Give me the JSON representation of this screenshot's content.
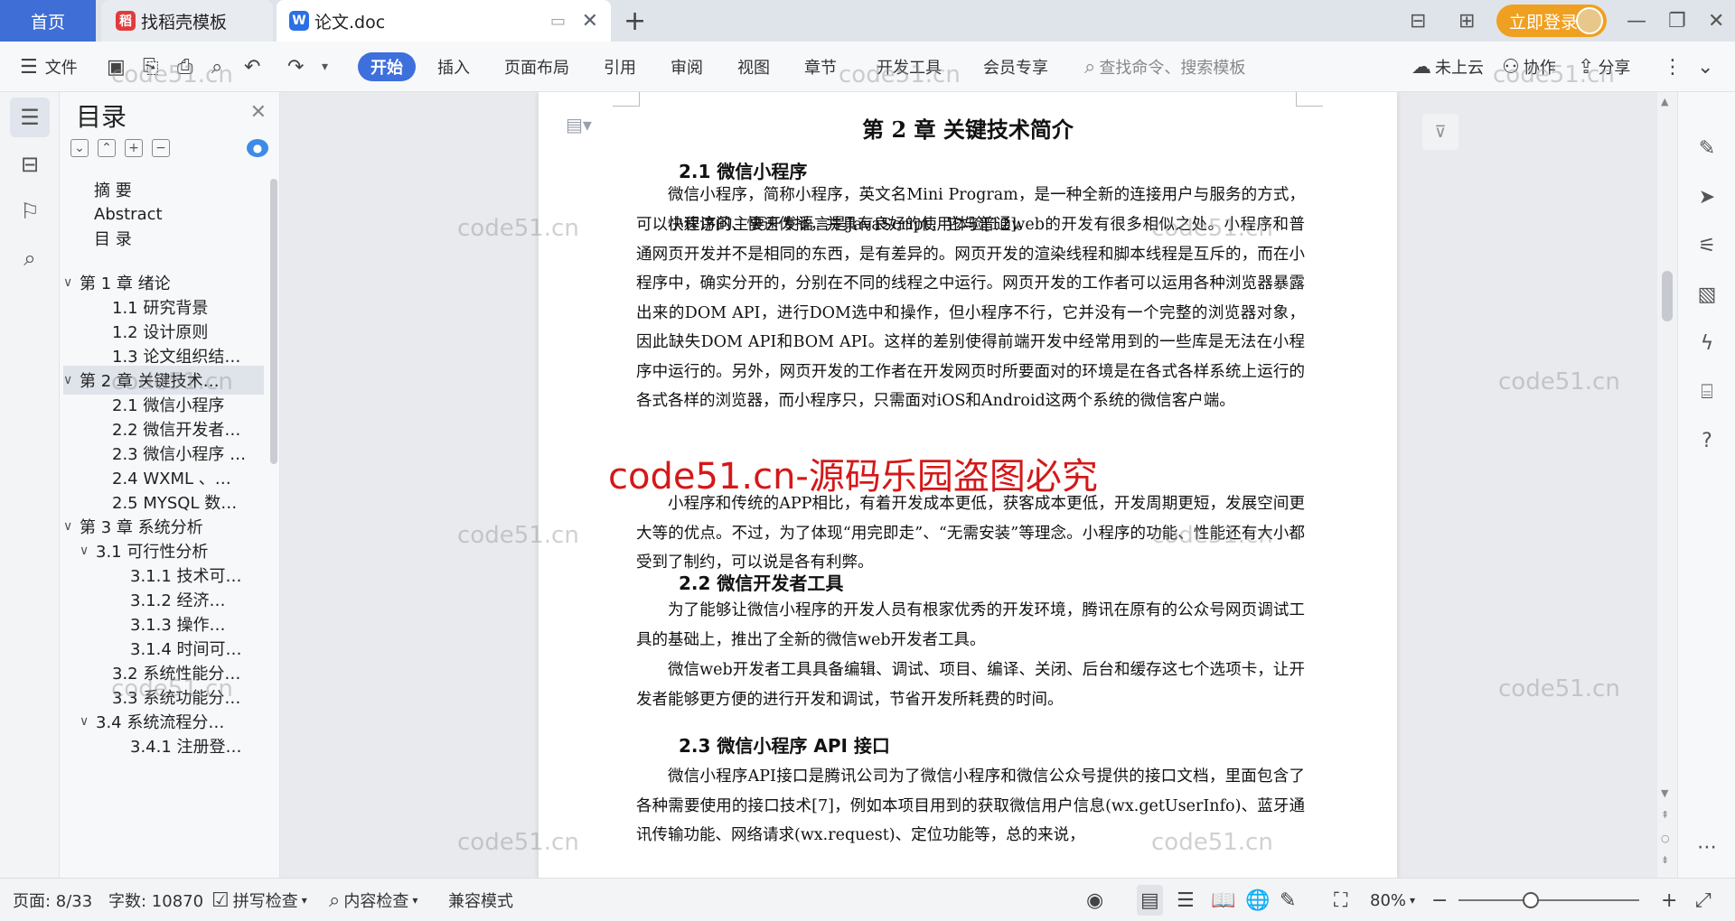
{
  "titlebar": {
    "home_tab": "首页",
    "tabs": [
      {
        "label": "找稻壳模板",
        "logo": "稻"
      },
      {
        "label": "论文.doc",
        "logo": "W"
      }
    ],
    "new_tab": "+",
    "login_label": "立即登录"
  },
  "ribbon": {
    "file_label": "文件",
    "tabs": [
      "开始",
      "插入",
      "页面布局",
      "引用",
      "审阅",
      "视图",
      "章节",
      "开发工具",
      "会员专享"
    ],
    "search_placeholder": "查找命令、搜索模板",
    "cloud_label": "未上云",
    "collab_label": "协作",
    "share_label": "分享"
  },
  "toc": {
    "title": "目录",
    "items": [
      {
        "label": "摘  要"
      },
      {
        "label": "Abstract"
      },
      {
        "label": "目    录"
      },
      {
        "label": "第 1 章   绪论",
        "chev": "∨"
      },
      {
        "label": "1.1 研究背景"
      },
      {
        "label": "1.2 设计原则"
      },
      {
        "label": "1.3 论文组织结…"
      },
      {
        "label": "第 2 章   关键技术…",
        "chev": "∨",
        "selected": true
      },
      {
        "label": "2.1  微信小程序"
      },
      {
        "label": "2.2  微信开发者…"
      },
      {
        "label": "2.3 微信小程序 …"
      },
      {
        "label": "2.4 WXML  、…"
      },
      {
        "label": "2.5 MYSQL 数…"
      },
      {
        "label": "第 3 章   系统分析",
        "chev": "∨"
      },
      {
        "label": "3.1  可行性分析",
        "chev": "∨"
      },
      {
        "label": "3.1.1 技术可…"
      },
      {
        "label": "3.1.2  经济…"
      },
      {
        "label": "3.1.3  操作…"
      },
      {
        "label": "3.1.4 时间可…"
      },
      {
        "label": "3.2  系统性能分…"
      },
      {
        "label": "3.3  系统功能分…"
      },
      {
        "label": "3.4  系统流程分…",
        "chev": "∨"
      },
      {
        "label": "3.4.1 注册登…"
      }
    ]
  },
  "document": {
    "chapter_title": "第 2 章    关键技术简介",
    "sections": [
      {
        "heading": "2.1  微信小程序"
      },
      {
        "heading": "2.2  微信开发者工具"
      },
      {
        "heading": "2.3 微信小程序 API 接口"
      }
    ],
    "paragraphs": [
      "微信小程序，简称小程序，英文名Mini Program，是一种全新的连接用户与服务的方式，可以快速访问、快速传播，并具有良好的使用体验[12]。",
      "小程序的主要开发语言是JavaScript，它与普通web的开发有很多相似之处。小程序和普通网页开发并不是相同的东西，是有差异的。网页开发的渲染线程和脚本线程是互斥的，而在小程序中，确实分开的，分别在不同的线程之中运行。网页开发的工作者可以运用各种浏览器暴露出来的DOM API，进行DOM选中和操作，但小程序不行，它并没有一个完整的浏览器对象，因此缺失DOM API和BOM API。这样的差别使得前端开发中经常用到的一些库是无法在小程序中运行的。另外，网页开发的工作者在开发网页时所要面对的环境是在各式各样系统上运行的各式各样的浏览器，而小程序只，只需面对iOS和Android这两个系统的微信客户端。",
      "小程序和传统的APP相比，有着开发成本更低，获客成本更低，开发周期更短，发展空间更大等的优点。不过，为了体现“用完即走”、“无需安装”等理念。小程序的功能、性能还有大小都受到了制约，可以说是各有利弊。",
      "为了能够让微信小程序的开发人员有根家优秀的开发环境，腾讯在原有的公众号网页调试工具的基础上，推出了全新的微信web开发者工具。",
      "微信web开发者工具具备编辑、调试、项目、编译、关闭、后台和缓存这七个选项卡，让开发者能够更方便的进行开发和调试，节省开发所耗费的时间。",
      "微信小程序API接口是腾讯公司为了微信小程序和微信公众号提供的接口文档，里面包含了各种需要使用的接口技术[7]，例如本项目用到的获取微信用户信息(wx.getUserInfo)、蓝牙通讯传输功能、网络请求(wx.request)、定位功能等，总的来说，"
    ]
  },
  "watermarks": {
    "small": "code51.cn",
    "big": "code51.cn-源码乐园盗图必究"
  },
  "statusbar": {
    "page": "页面: 8/33",
    "words": "字数: 10870",
    "spell_check": "拼写检查",
    "content_check": "内容检查",
    "compat_mode": "兼容模式",
    "zoom": "80%",
    "zoom_level_percent": 80
  },
  "colors": {
    "accent": "#3d6fdd",
    "login": "#f0a020",
    "watermark_red": "#d41818"
  }
}
